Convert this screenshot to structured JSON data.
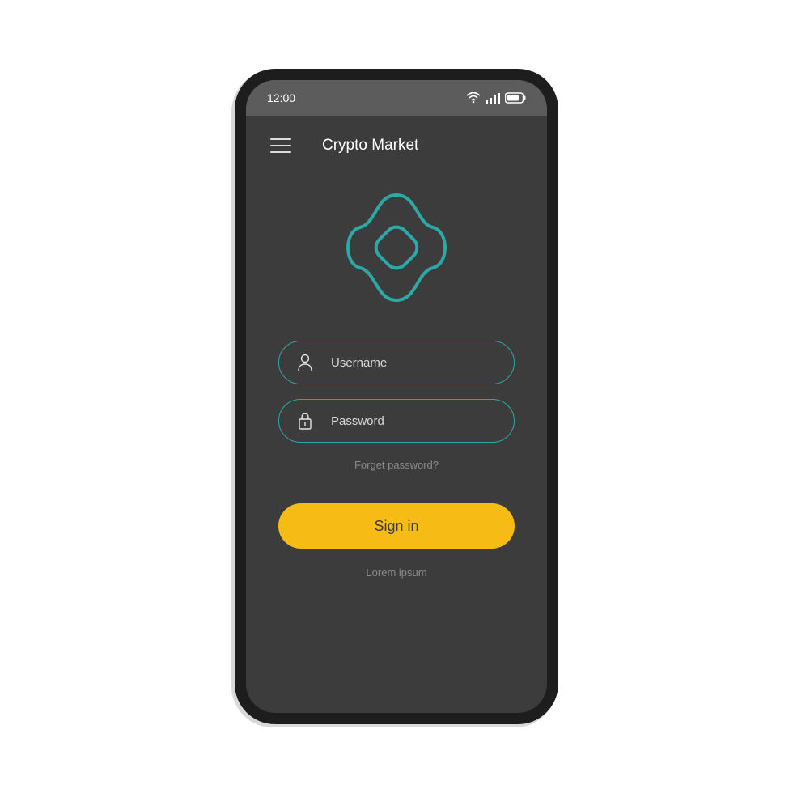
{
  "statusbar": {
    "time": "12:00"
  },
  "header": {
    "title": "Crypto Market"
  },
  "form": {
    "username_placeholder": "Username",
    "password_placeholder": "Password",
    "forgot": "Forget password?"
  },
  "actions": {
    "signin": "Sign in",
    "footer": "Lorem ipsum"
  },
  "colors": {
    "accent": "#2aa9a6",
    "button": "#f7bb16",
    "bg": "#3c3c3c"
  }
}
